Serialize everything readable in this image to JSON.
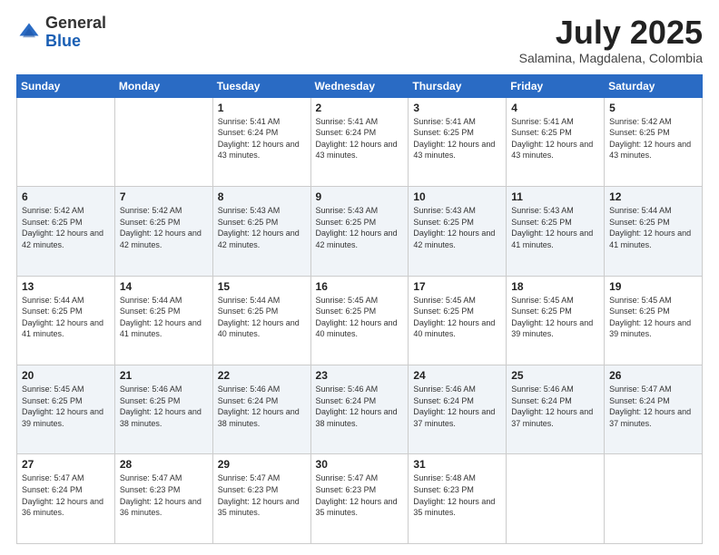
{
  "header": {
    "logo_general": "General",
    "logo_blue": "Blue",
    "month_title": "July 2025",
    "location": "Salamina, Magdalena, Colombia"
  },
  "weekdays": [
    "Sunday",
    "Monday",
    "Tuesday",
    "Wednesday",
    "Thursday",
    "Friday",
    "Saturday"
  ],
  "weeks": [
    [
      {
        "day": "",
        "sunrise": "",
        "sunset": "",
        "daylight": ""
      },
      {
        "day": "",
        "sunrise": "",
        "sunset": "",
        "daylight": ""
      },
      {
        "day": "1",
        "sunrise": "Sunrise: 5:41 AM",
        "sunset": "Sunset: 6:24 PM",
        "daylight": "Daylight: 12 hours and 43 minutes."
      },
      {
        "day": "2",
        "sunrise": "Sunrise: 5:41 AM",
        "sunset": "Sunset: 6:24 PM",
        "daylight": "Daylight: 12 hours and 43 minutes."
      },
      {
        "day": "3",
        "sunrise": "Sunrise: 5:41 AM",
        "sunset": "Sunset: 6:25 PM",
        "daylight": "Daylight: 12 hours and 43 minutes."
      },
      {
        "day": "4",
        "sunrise": "Sunrise: 5:41 AM",
        "sunset": "Sunset: 6:25 PM",
        "daylight": "Daylight: 12 hours and 43 minutes."
      },
      {
        "day": "5",
        "sunrise": "Sunrise: 5:42 AM",
        "sunset": "Sunset: 6:25 PM",
        "daylight": "Daylight: 12 hours and 43 minutes."
      }
    ],
    [
      {
        "day": "6",
        "sunrise": "Sunrise: 5:42 AM",
        "sunset": "Sunset: 6:25 PM",
        "daylight": "Daylight: 12 hours and 42 minutes."
      },
      {
        "day": "7",
        "sunrise": "Sunrise: 5:42 AM",
        "sunset": "Sunset: 6:25 PM",
        "daylight": "Daylight: 12 hours and 42 minutes."
      },
      {
        "day": "8",
        "sunrise": "Sunrise: 5:43 AM",
        "sunset": "Sunset: 6:25 PM",
        "daylight": "Daylight: 12 hours and 42 minutes."
      },
      {
        "day": "9",
        "sunrise": "Sunrise: 5:43 AM",
        "sunset": "Sunset: 6:25 PM",
        "daylight": "Daylight: 12 hours and 42 minutes."
      },
      {
        "day": "10",
        "sunrise": "Sunrise: 5:43 AM",
        "sunset": "Sunset: 6:25 PM",
        "daylight": "Daylight: 12 hours and 42 minutes."
      },
      {
        "day": "11",
        "sunrise": "Sunrise: 5:43 AM",
        "sunset": "Sunset: 6:25 PM",
        "daylight": "Daylight: 12 hours and 41 minutes."
      },
      {
        "day": "12",
        "sunrise": "Sunrise: 5:44 AM",
        "sunset": "Sunset: 6:25 PM",
        "daylight": "Daylight: 12 hours and 41 minutes."
      }
    ],
    [
      {
        "day": "13",
        "sunrise": "Sunrise: 5:44 AM",
        "sunset": "Sunset: 6:25 PM",
        "daylight": "Daylight: 12 hours and 41 minutes."
      },
      {
        "day": "14",
        "sunrise": "Sunrise: 5:44 AM",
        "sunset": "Sunset: 6:25 PM",
        "daylight": "Daylight: 12 hours and 41 minutes."
      },
      {
        "day": "15",
        "sunrise": "Sunrise: 5:44 AM",
        "sunset": "Sunset: 6:25 PM",
        "daylight": "Daylight: 12 hours and 40 minutes."
      },
      {
        "day": "16",
        "sunrise": "Sunrise: 5:45 AM",
        "sunset": "Sunset: 6:25 PM",
        "daylight": "Daylight: 12 hours and 40 minutes."
      },
      {
        "day": "17",
        "sunrise": "Sunrise: 5:45 AM",
        "sunset": "Sunset: 6:25 PM",
        "daylight": "Daylight: 12 hours and 40 minutes."
      },
      {
        "day": "18",
        "sunrise": "Sunrise: 5:45 AM",
        "sunset": "Sunset: 6:25 PM",
        "daylight": "Daylight: 12 hours and 39 minutes."
      },
      {
        "day": "19",
        "sunrise": "Sunrise: 5:45 AM",
        "sunset": "Sunset: 6:25 PM",
        "daylight": "Daylight: 12 hours and 39 minutes."
      }
    ],
    [
      {
        "day": "20",
        "sunrise": "Sunrise: 5:45 AM",
        "sunset": "Sunset: 6:25 PM",
        "daylight": "Daylight: 12 hours and 39 minutes."
      },
      {
        "day": "21",
        "sunrise": "Sunrise: 5:46 AM",
        "sunset": "Sunset: 6:25 PM",
        "daylight": "Daylight: 12 hours and 38 minutes."
      },
      {
        "day": "22",
        "sunrise": "Sunrise: 5:46 AM",
        "sunset": "Sunset: 6:24 PM",
        "daylight": "Daylight: 12 hours and 38 minutes."
      },
      {
        "day": "23",
        "sunrise": "Sunrise: 5:46 AM",
        "sunset": "Sunset: 6:24 PM",
        "daylight": "Daylight: 12 hours and 38 minutes."
      },
      {
        "day": "24",
        "sunrise": "Sunrise: 5:46 AM",
        "sunset": "Sunset: 6:24 PM",
        "daylight": "Daylight: 12 hours and 37 minutes."
      },
      {
        "day": "25",
        "sunrise": "Sunrise: 5:46 AM",
        "sunset": "Sunset: 6:24 PM",
        "daylight": "Daylight: 12 hours and 37 minutes."
      },
      {
        "day": "26",
        "sunrise": "Sunrise: 5:47 AM",
        "sunset": "Sunset: 6:24 PM",
        "daylight": "Daylight: 12 hours and 37 minutes."
      }
    ],
    [
      {
        "day": "27",
        "sunrise": "Sunrise: 5:47 AM",
        "sunset": "Sunset: 6:24 PM",
        "daylight": "Daylight: 12 hours and 36 minutes."
      },
      {
        "day": "28",
        "sunrise": "Sunrise: 5:47 AM",
        "sunset": "Sunset: 6:23 PM",
        "daylight": "Daylight: 12 hours and 36 minutes."
      },
      {
        "day": "29",
        "sunrise": "Sunrise: 5:47 AM",
        "sunset": "Sunset: 6:23 PM",
        "daylight": "Daylight: 12 hours and 35 minutes."
      },
      {
        "day": "30",
        "sunrise": "Sunrise: 5:47 AM",
        "sunset": "Sunset: 6:23 PM",
        "daylight": "Daylight: 12 hours and 35 minutes."
      },
      {
        "day": "31",
        "sunrise": "Sunrise: 5:48 AM",
        "sunset": "Sunset: 6:23 PM",
        "daylight": "Daylight: 12 hours and 35 minutes."
      },
      {
        "day": "",
        "sunrise": "",
        "sunset": "",
        "daylight": ""
      },
      {
        "day": "",
        "sunrise": "",
        "sunset": "",
        "daylight": ""
      }
    ]
  ]
}
